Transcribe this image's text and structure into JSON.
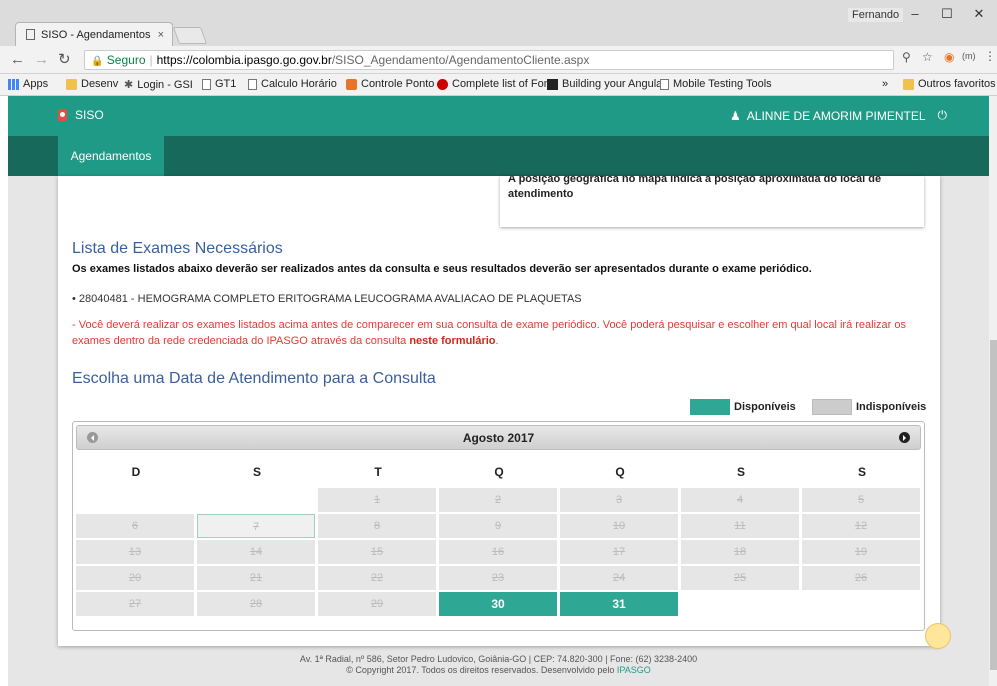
{
  "browser": {
    "tab_title": "SISO - Agendamentos",
    "tab_close": "×",
    "profile_name": "Fernando",
    "secure_label": "Seguro",
    "url_host": "https://colombia.ipasgo.go.gov.br",
    "url_path": "/SISO_Agendamento/AgendamentoCliente.aspx",
    "bookmarks": [
      "Apps",
      "Desenv",
      "Login - GSI",
      "GT1",
      "Calculo Horário",
      "Controle Ponto",
      "Complete list of Font",
      "Building your Angular",
      "Mobile Testing Tools"
    ],
    "bookmarks_overflow": "»",
    "other_bookmarks": "Outros favoritos"
  },
  "app": {
    "brand": "SISO",
    "user_name": "ALINNE DE AMORIM PIMENTEL",
    "menu_item": "Agendamentos"
  },
  "map_note": "A posição geográfica no mapa indica à posição aproximada do local de atendimento",
  "exams": {
    "title": "Lista de Exames Necessários",
    "subtitle": "Os exames listados abaixo deverão ser realizados antes da consulta e seus resultados deverão ser apresentados durante o exame periódico.",
    "items": [
      "28040481 - HEMOGRAMA COMPLETO ERITOGRAMA LEUCOGRAMA AVALIACAO DE PLAQUETAS"
    ],
    "notice": "- Você deverá realizar os exames listados acima antes de comparecer em sua consulta de exame periódico. Você poderá pesquisar e escolher em qual local irá realizar os exames dentro da rede credenciada do IPASGO através da consulta ",
    "notice_link": "neste formulário",
    "notice_end": "."
  },
  "schedule": {
    "title": "Escolha uma Data de Atendimento para a Consulta",
    "legend_available": "Disponíveis",
    "legend_unavailable": "Indisponíveis",
    "month_label": "Agosto 2017",
    "weekdays": [
      "D",
      "S",
      "T",
      "Q",
      "Q",
      "S",
      "S"
    ],
    "weeks": [
      [
        "",
        "",
        "1",
        "2",
        "3",
        "4",
        "5"
      ],
      [
        "6",
        "7",
        "8",
        "9",
        "10",
        "11",
        "12"
      ],
      [
        "13",
        "14",
        "15",
        "16",
        "17",
        "18",
        "19"
      ],
      [
        "20",
        "21",
        "22",
        "23",
        "24",
        "25",
        "26"
      ],
      [
        "27",
        "28",
        "29",
        "30",
        "31",
        "",
        ""
      ]
    ],
    "available_days": [
      "30",
      "31"
    ],
    "highlighted_day": "7"
  },
  "footer": {
    "address": "Av. 1ª Radial, nº 586, Setor Pedro Ludovico, Goiânia-GO | CEP: 74.820-300 | Fone: (62) 3238-2400",
    "copyright": "© Copyright 2017. Todos os direitos reservados. Desenvolvido pelo ",
    "developer": "IPASGO"
  },
  "colors": {
    "primary": "#1f9a86",
    "primary_dark": "#17695b",
    "available": "#2fa795",
    "unavailable": "#cccccc",
    "title": "#3a5f9f",
    "warning": "#e03c31"
  }
}
